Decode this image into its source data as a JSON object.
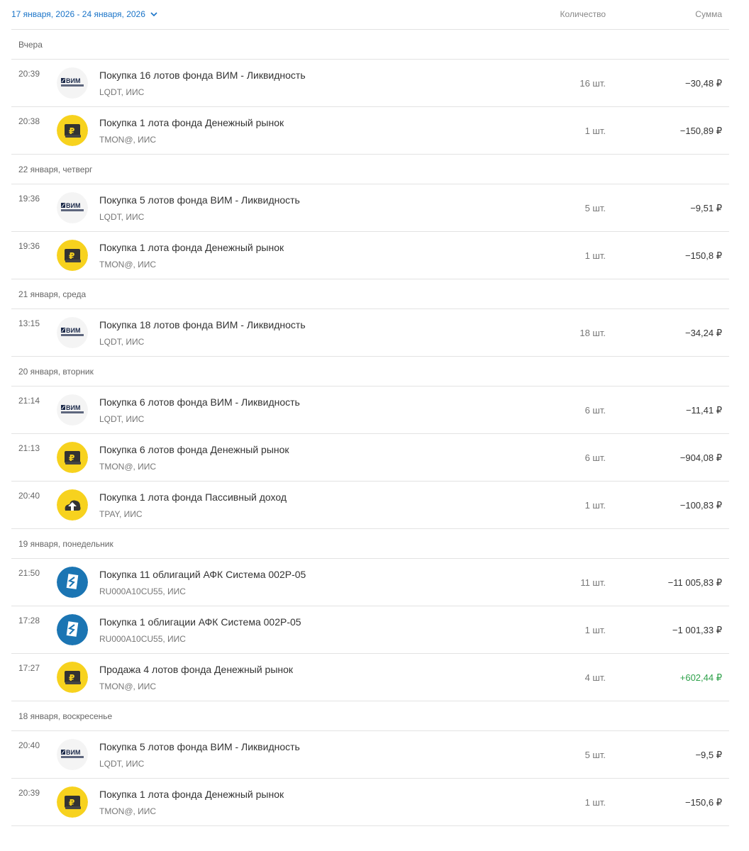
{
  "header": {
    "date_range": "17 января, 2026 - 24 января, 2026",
    "col_qty": "Количество",
    "col_sum": "Сумма"
  },
  "colors": {
    "accent": "#1a74c8",
    "positive": "#2ea14a",
    "yellow": "#f7d21e",
    "blue": "#1b75b3"
  },
  "groups": [
    {
      "label": "Вчера",
      "rows": [
        {
          "time": "20:39",
          "logo": "vim",
          "title": "Покупка 16 лотов фонда ВИМ - Ликвидность",
          "sub": "LQDT, ИИС",
          "qty": "16 шт.",
          "sum": "−30,48 ₽",
          "positive": false
        },
        {
          "time": "20:38",
          "logo": "tmon",
          "title": "Покупка 1 лота фонда Денежный рынок",
          "sub": "TMON@, ИИС",
          "qty": "1 шт.",
          "sum": "−150,89 ₽",
          "positive": false
        }
      ]
    },
    {
      "label": "22 января, четверг",
      "rows": [
        {
          "time": "19:36",
          "logo": "vim",
          "title": "Покупка 5 лотов фонда ВИМ - Ликвидность",
          "sub": "LQDT, ИИС",
          "qty": "5 шт.",
          "sum": "−9,51 ₽",
          "positive": false
        },
        {
          "time": "19:36",
          "logo": "tmon",
          "title": "Покупка 1 лота фонда Денежный рынок",
          "sub": "TMON@, ИИС",
          "qty": "1 шт.",
          "sum": "−150,8 ₽",
          "positive": false
        }
      ]
    },
    {
      "label": "21 января, среда",
      "rows": [
        {
          "time": "13:15",
          "logo": "vim",
          "title": "Покупка 18 лотов фонда ВИМ - Ликвидность",
          "sub": "LQDT, ИИС",
          "qty": "18 шт.",
          "sum": "−34,24 ₽",
          "positive": false
        }
      ]
    },
    {
      "label": "20 января, вторник",
      "rows": [
        {
          "time": "21:14",
          "logo": "vim",
          "title": "Покупка 6 лотов фонда ВИМ - Ликвидность",
          "sub": "LQDT, ИИС",
          "qty": "6 шт.",
          "sum": "−11,41 ₽",
          "positive": false
        },
        {
          "time": "21:13",
          "logo": "tmon",
          "title": "Покупка 6 лотов фонда Денежный рынок",
          "sub": "TMON@, ИИС",
          "qty": "6 шт.",
          "sum": "−904,08 ₽",
          "positive": false
        },
        {
          "time": "20:40",
          "logo": "tpay",
          "title": "Покупка 1 лота фонда Пассивный доход",
          "sub": "TPAY, ИИС",
          "qty": "1 шт.",
          "sum": "−100,83 ₽",
          "positive": false
        }
      ]
    },
    {
      "label": "19 января, понедельник",
      "rows": [
        {
          "time": "21:50",
          "logo": "afk",
          "title": "Покупка 11 облигаций АФК Система 002P-05",
          "sub": "RU000A10CU55, ИИС",
          "qty": "11 шт.",
          "sum": "−11 005,83 ₽",
          "positive": false
        },
        {
          "time": "17:28",
          "logo": "afk",
          "title": "Покупка 1 облигации АФК Система 002P-05",
          "sub": "RU000A10CU55, ИИС",
          "qty": "1 шт.",
          "sum": "−1 001,33 ₽",
          "positive": false
        },
        {
          "time": "17:27",
          "logo": "tmon",
          "title": "Продажа 4 лотов фонда Денежный рынок",
          "sub": "TMON@, ИИС",
          "qty": "4 шт.",
          "sum": "+602,44 ₽",
          "positive": true
        }
      ]
    },
    {
      "label": "18 января, воскресенье",
      "rows": [
        {
          "time": "20:40",
          "logo": "vim",
          "title": "Покупка 5 лотов фонда ВИМ - Ликвидность",
          "sub": "LQDT, ИИС",
          "qty": "5 шт.",
          "sum": "−9,5 ₽",
          "positive": false
        },
        {
          "time": "20:39",
          "logo": "tmon",
          "title": "Покупка 1 лота фонда Денежный рынок",
          "sub": "TMON@, ИИС",
          "qty": "1 шт.",
          "sum": "−150,6 ₽",
          "positive": false
        }
      ]
    }
  ]
}
